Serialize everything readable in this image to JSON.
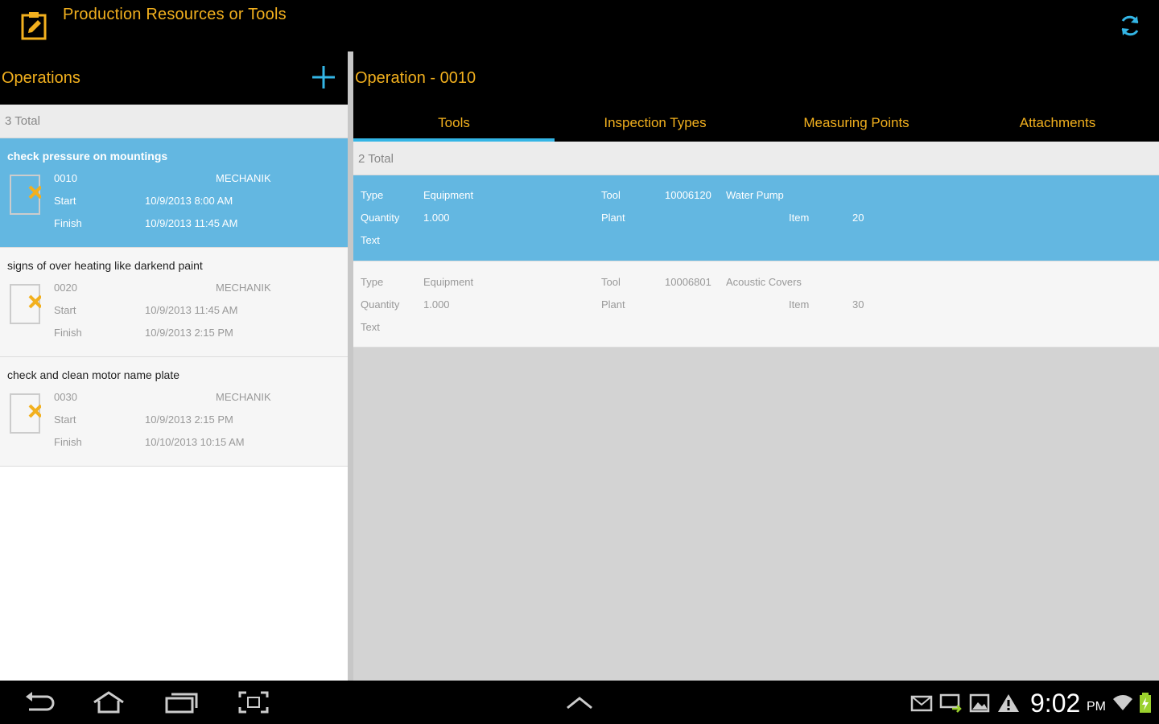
{
  "app": {
    "title": "Production Resources or Tools",
    "icon": "clipboard-edit-icon",
    "refresh_icon": "refresh-icon"
  },
  "colors": {
    "accent": "#f2b01e",
    "selection": "#63b7e1",
    "tab_indicator": "#33b5e5"
  },
  "operations": {
    "title": "Operations",
    "add_icon": "plus-icon",
    "total": "3 Total",
    "items": [
      {
        "title": "check pressure on mountings",
        "number": "0010",
        "group": "MECHANIK",
        "start_label": "Start",
        "start": "10/9/2013 8:00 AM",
        "finish_label": "Finish",
        "finish": "10/9/2013 11:45 AM",
        "selected": true
      },
      {
        "title": "signs of over heating like darkend paint",
        "number": "0020",
        "group": "MECHANIK",
        "start_label": "Start",
        "start": "10/9/2013 11:45 AM",
        "finish_label": "Finish",
        "finish": "10/9/2013 2:15 PM",
        "selected": false
      },
      {
        "title": "check and clean motor name plate",
        "number": "0030",
        "group": "MECHANIK",
        "start_label": "Start",
        "start": "10/9/2013 2:15 PM",
        "finish_label": "Finish",
        "finish": "10/10/2013 10:15 AM",
        "selected": false
      }
    ]
  },
  "detail": {
    "title": "Operation - 0010",
    "tabs": [
      "Tools",
      "Inspection Types",
      "Measuring Points",
      "Attachments"
    ],
    "active_tab": "Tools",
    "total": "2 Total",
    "tools": [
      {
        "type_label": "Type",
        "type": "Equipment",
        "quantity_label": "Quantity",
        "quantity": "1.000",
        "text_label": "Text",
        "tool_label": "Tool",
        "tool_id": "10006120",
        "tool_name": "Water Pump",
        "plant_label": "Plant",
        "item_label": "Item",
        "item": "20",
        "selected": true
      },
      {
        "type_label": "Type",
        "type": "Equipment",
        "quantity_label": "Quantity",
        "quantity": "1.000",
        "text_label": "Text",
        "tool_label": "Tool",
        "tool_id": "10006801",
        "tool_name": "Acoustic Covers",
        "plant_label": "Plant",
        "item_label": "Item",
        "item": "30",
        "selected": false
      }
    ]
  },
  "system_bar": {
    "time": "9:02",
    "ampm": "PM",
    "nav_icons": [
      "back-icon",
      "home-icon",
      "recent-apps-icon",
      "screenshot-icon",
      "chevron-up-icon"
    ],
    "status_icons": [
      "mail-icon",
      "sync-icon",
      "gallery-icon",
      "warning-icon",
      "wifi-icon",
      "battery-icon"
    ]
  }
}
